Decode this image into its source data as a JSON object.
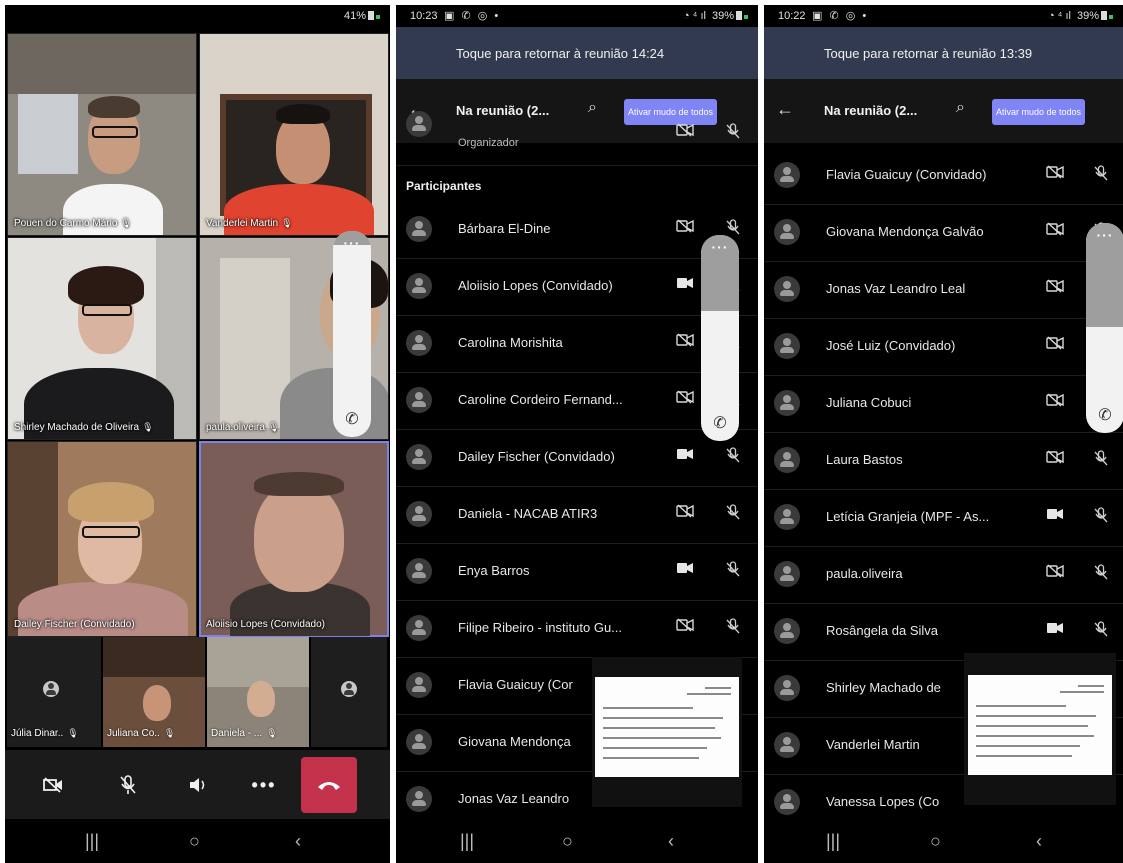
{
  "phone1": {
    "status": {
      "battery": "41%"
    },
    "tiles": [
      {
        "name": "Pouen do Carmo Mário"
      },
      {
        "name": "Vanderlei Martin"
      },
      {
        "name": "Shirley Machado de Oliveira"
      },
      {
        "name": "paula.oliveira"
      },
      {
        "name": "Dailey Fischer (Convidado)"
      },
      {
        "name": "Aloiisio Lopes (Convidado)"
      }
    ],
    "small_tiles": [
      {
        "name": "Júlia Dinar.."
      },
      {
        "name": "Juliana Co.."
      },
      {
        "name": "Daniela - ..."
      }
    ],
    "controls": [
      "camera-off-icon",
      "mic-off-icon",
      "speaker-icon",
      "more-icon",
      "hangup-icon"
    ]
  },
  "phone2": {
    "status": {
      "time": "10:23",
      "battery": "39%"
    },
    "banner": "Toque para retornar à reunião 14:24",
    "header": {
      "title": "Na reunião (2...",
      "mute_all": "Ativar mudo de todos"
    },
    "organizer_label": "Organizador",
    "section": "Participantes",
    "participants": [
      {
        "name": "Bárbara El-Dine",
        "cam": "off",
        "mic": "off"
      },
      {
        "name": "Aloiisio Lopes (Convidado)",
        "cam": "on",
        "mic": "off"
      },
      {
        "name": "Carolina Morishita",
        "cam": "off",
        "mic": "off"
      },
      {
        "name": "Caroline Cordeiro Fernand...",
        "cam": "off",
        "mic": "off"
      },
      {
        "name": "Dailey Fischer (Convidado)",
        "cam": "on",
        "mic": "off"
      },
      {
        "name": "Daniela -  NACAB ATIR3",
        "cam": "off",
        "mic": "off"
      },
      {
        "name": "Enya Barros",
        "cam": "on",
        "mic": "off"
      },
      {
        "name": "Filipe Ribeiro - instituto Gu...",
        "cam": "off",
        "mic": "off"
      },
      {
        "name": "Flavia Guaicuy (Cor",
        "cam": "",
        "mic": ""
      },
      {
        "name": "Giovana Mendonça",
        "cam": "",
        "mic": ""
      },
      {
        "name": "Jonas Vaz Leandro",
        "cam": "",
        "mic": ""
      }
    ]
  },
  "phone3": {
    "status": {
      "time": "10:22",
      "battery": "39%"
    },
    "banner": "Toque para retornar à reunião 13:39",
    "header": {
      "title": "Na reunião (2...",
      "mute_all": "Ativar mudo de todos"
    },
    "participants": [
      {
        "name": "Flavia Guaicuy (Convidado)",
        "cam": "off",
        "mic": "off"
      },
      {
        "name": "Giovana Mendonça Galvão",
        "cam": "off",
        "mic": "off"
      },
      {
        "name": "Jonas Vaz Leandro Leal",
        "cam": "off",
        "mic": ""
      },
      {
        "name": "José Luiz (Convidado)",
        "cam": "off",
        "mic": ""
      },
      {
        "name": "Juliana Cobuci",
        "cam": "off",
        "mic": ""
      },
      {
        "name": "Laura Bastos",
        "cam": "off",
        "mic": "off"
      },
      {
        "name": "Letícia Granjeia (MPF - As...",
        "cam": "on",
        "mic": "off"
      },
      {
        "name": "paula.oliveira",
        "cam": "off",
        "mic": "off"
      },
      {
        "name": "Rosângela da Silva",
        "cam": "on",
        "mic": "off"
      },
      {
        "name": "Shirley Machado de",
        "cam": "",
        "mic": ""
      },
      {
        "name": "Vanderlei Martin",
        "cam": "",
        "mic": ""
      },
      {
        "name": "Vanessa Lopes (Co",
        "cam": "",
        "mic": ""
      }
    ]
  },
  "colors": {
    "banner": "#323a4f",
    "accent": "#7f85f5",
    "hangup": "#c4314b",
    "background": "#000000"
  }
}
